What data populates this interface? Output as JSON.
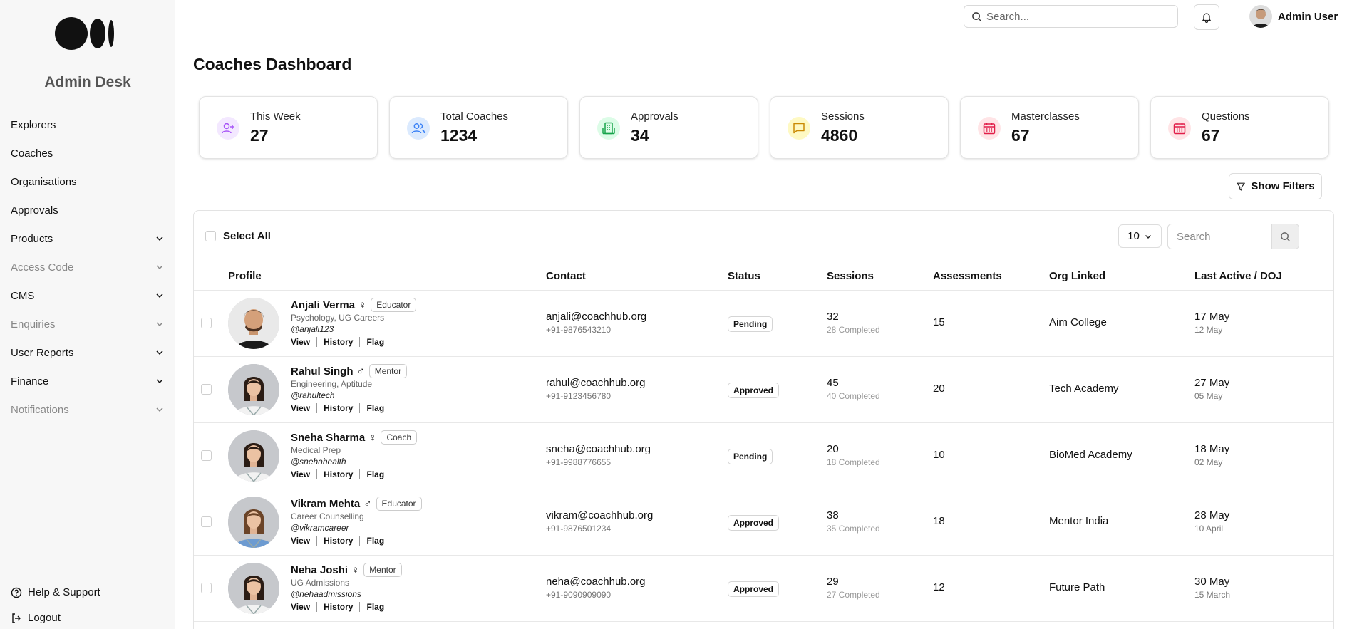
{
  "sidebar": {
    "brand": "Admin Desk",
    "items": [
      {
        "label": "Explorers",
        "expandable": false,
        "muted": false
      },
      {
        "label": "Coaches",
        "expandable": false,
        "muted": false
      },
      {
        "label": "Organisations",
        "expandable": false,
        "muted": false
      },
      {
        "label": "Approvals",
        "expandable": false,
        "muted": false
      },
      {
        "label": "Products",
        "expandable": true,
        "muted": false
      },
      {
        "label": "Access Code",
        "expandable": true,
        "muted": true
      },
      {
        "label": "CMS",
        "expandable": true,
        "muted": false
      },
      {
        "label": "Enquiries",
        "expandable": true,
        "muted": true
      },
      {
        "label": "User Reports",
        "expandable": true,
        "muted": false
      },
      {
        "label": "Finance",
        "expandable": true,
        "muted": false
      },
      {
        "label": "Notifications",
        "expandable": true,
        "muted": true
      }
    ],
    "help": "Help & Support",
    "logout": "Logout"
  },
  "header": {
    "search_placeholder": "Search...",
    "user_name": "Admin User"
  },
  "page": {
    "title": "Coaches Dashboard",
    "filters_label": "Show Filters"
  },
  "stats": [
    {
      "label": "This Week",
      "value": "27",
      "icon": "user-plus-icon",
      "color": "#a855f7",
      "bg": "#f3e8ff"
    },
    {
      "label": "Total Coaches",
      "value": "1234",
      "icon": "users-icon",
      "color": "#3b82f6",
      "bg": "#dbeafe"
    },
    {
      "label": "Approvals",
      "value": "34",
      "icon": "building-icon",
      "color": "#16a34a",
      "bg": "#dcfce7"
    },
    {
      "label": "Sessions",
      "value": "4860",
      "icon": "message-icon",
      "color": "#ca8a04",
      "bg": "#fef9c3"
    },
    {
      "label": "Masterclasses",
      "value": "67",
      "icon": "calendar-icon",
      "color": "#e11d48",
      "bg": "#ffe4e6"
    },
    {
      "label": "Questions",
      "value": "67",
      "icon": "calendar-icon",
      "color": "#e11d48",
      "bg": "#ffe4e6"
    }
  ],
  "table": {
    "select_all": "Select All",
    "page_size": "10",
    "search_placeholder": "Search",
    "columns": [
      "Profile",
      "Contact",
      "Status",
      "Sessions",
      "Assessments",
      "Org Linked",
      "Last Active / DOJ"
    ],
    "actions": [
      "View",
      "History",
      "Flag"
    ],
    "rows": [
      {
        "name": "Anjali Verma",
        "gender": "♀",
        "role": "Educator",
        "spec": "Psychology, UG Careers",
        "handle": "@anjali123",
        "email": "anjali@coachhub.org",
        "phone": "+91-9876543210",
        "status": "Pending",
        "sessions": "32",
        "completed": "28 Completed",
        "assessments": "15",
        "org": "Aim College",
        "last_active": "17 May",
        "doj": "12 May",
        "avatar": "male"
      },
      {
        "name": "Rahul Singh",
        "gender": "♂",
        "role": "Mentor",
        "spec": "Engineering, Aptitude",
        "handle": "@rahultech",
        "email": "rahul@coachhub.org",
        "phone": "+91-9123456780",
        "status": "Approved",
        "sessions": "45",
        "completed": "40 Completed",
        "assessments": "20",
        "org": "Tech Academy",
        "last_active": "27 May",
        "doj": "05 May",
        "avatar": "female"
      },
      {
        "name": "Sneha Sharma",
        "gender": "♀",
        "role": "Coach",
        "spec": "Medical Prep",
        "handle": "@snehahealth",
        "email": "sneha@coachhub.org",
        "phone": "+91-9988776655",
        "status": "Pending",
        "sessions": "20",
        "completed": "18 Completed",
        "assessments": "10",
        "org": "BioMed Academy",
        "last_active": "18 May",
        "doj": "02 May",
        "avatar": "female"
      },
      {
        "name": "Vikram Mehta",
        "gender": "♂",
        "role": "Educator",
        "spec": "Career Counselling",
        "handle": "@vikramcareer",
        "email": "vikram@coachhub.org",
        "phone": "+91-9876501234",
        "status": "Approved",
        "sessions": "38",
        "completed": "35 Completed",
        "assessments": "18",
        "org": "Mentor India",
        "last_active": "28 May",
        "doj": "10 April",
        "avatar": "female2"
      },
      {
        "name": "Neha Joshi",
        "gender": "♀",
        "role": "Mentor",
        "spec": "UG Admissions",
        "handle": "@nehaadmissions",
        "email": "neha@coachhub.org",
        "phone": "+91-9090909090",
        "status": "Approved",
        "sessions": "29",
        "completed": "27 Completed",
        "assessments": "12",
        "org": "Future Path",
        "last_active": "30 May",
        "doj": "15 March",
        "avatar": "female"
      }
    ]
  }
}
